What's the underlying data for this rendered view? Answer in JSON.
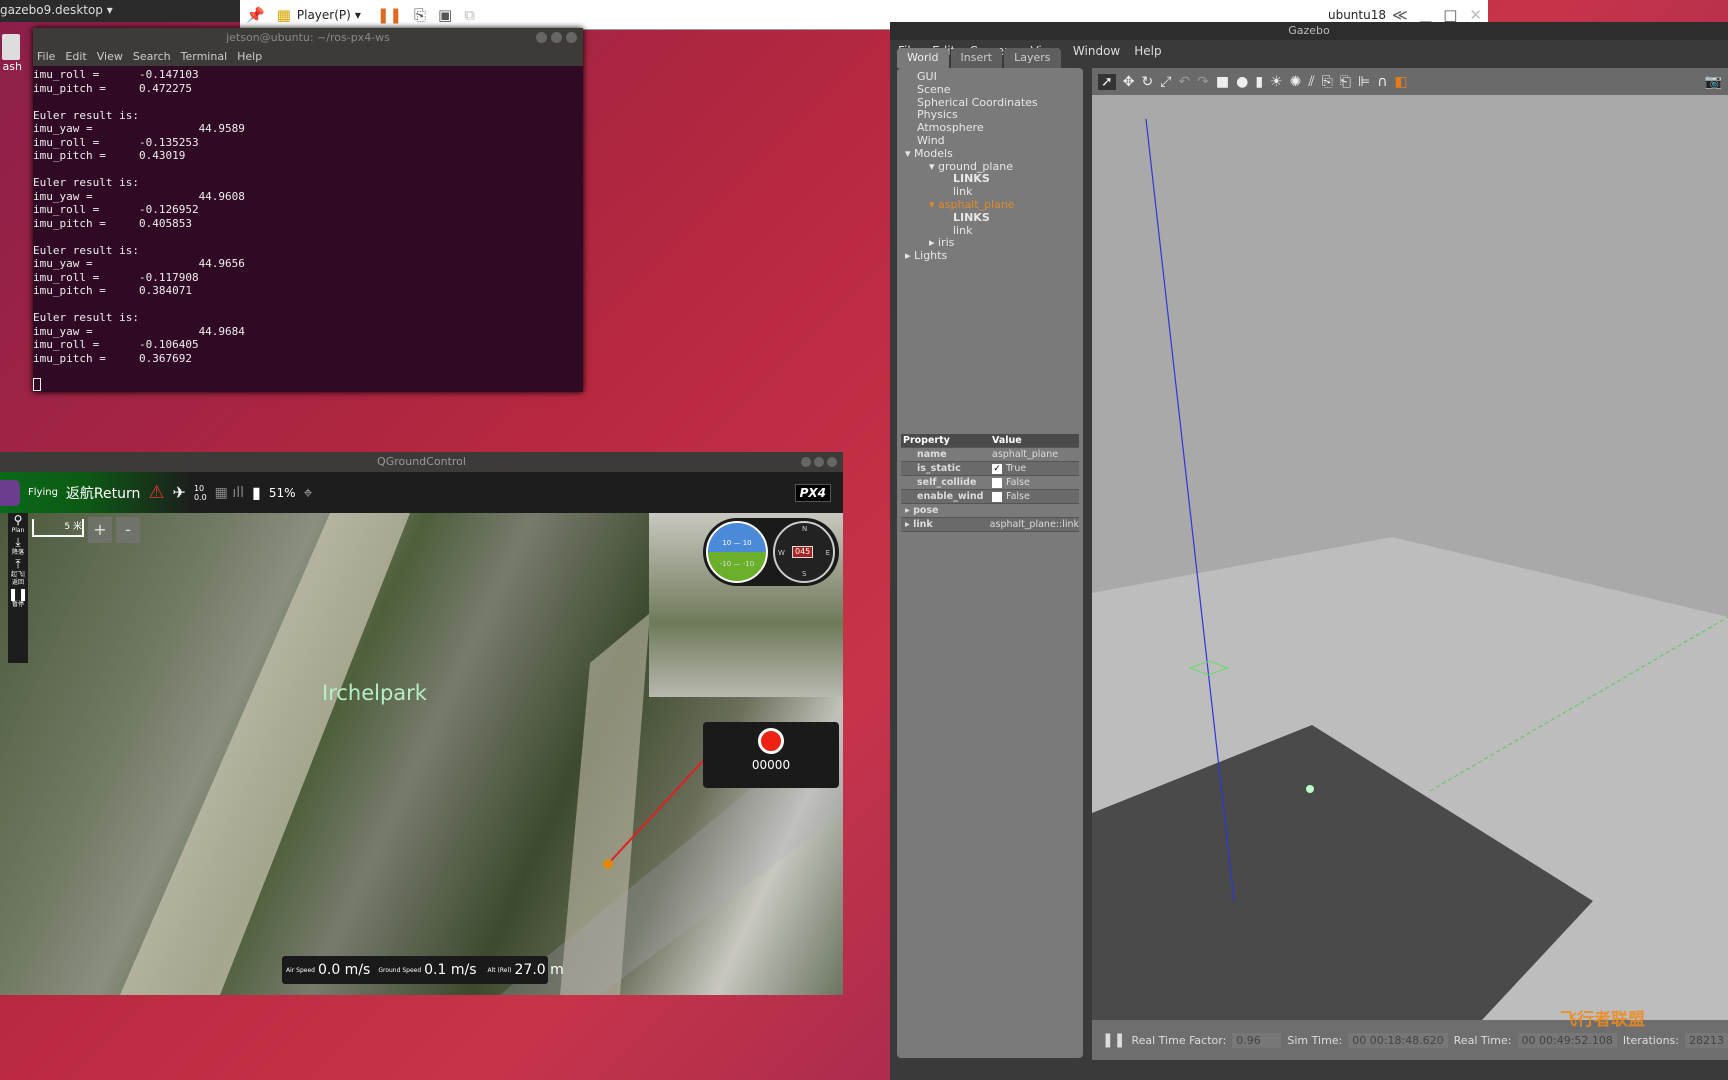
{
  "desktop": {
    "topbar": "gazebo9.desktop ▾",
    "trash": "ash"
  },
  "player": {
    "name": "Player(P)",
    "host": "ubuntu18"
  },
  "terminal": {
    "title": "jetson@ubuntu: ~/ros-px4-ws",
    "menu": [
      "File",
      "Edit",
      "View",
      "Search",
      "Terminal",
      "Help"
    ],
    "lines": [
      "imu_roll =      -0.147103",
      "imu_pitch =     0.472275",
      "",
      "Euler result is:",
      "imu_yaw =                44.9589",
      "imu_roll =      -0.135253",
      "imu_pitch =     0.43019",
      "",
      "Euler result is:",
      "imu_yaw =                44.9608",
      "imu_roll =      -0.126952",
      "imu_pitch =     0.405853",
      "",
      "Euler result is:",
      "imu_yaw =                44.9656",
      "imu_roll =      -0.117908",
      "imu_pitch =     0.384071",
      "",
      "Euler result is:",
      "imu_yaw =                44.9684",
      "imu_roll =      -0.106405",
      "imu_pitch =     0.367692",
      ""
    ]
  },
  "qgc": {
    "title": "QGroundControl",
    "status": "Flying",
    "mode": "返航Return",
    "gps_count": "10",
    "gps_hdop": "0.0",
    "battery": "51%",
    "logo": "PX4 autopilot",
    "scale": "5 米",
    "zoom_in": "+",
    "zoom_out": "-",
    "left_tools": [
      "Plan",
      "降落",
      "起飞|返回",
      "暂停"
    ],
    "place": "Irchelpark",
    "heading": "045",
    "compass": [
      "N",
      "E",
      "S",
      "W"
    ],
    "pitch_labels": [
      "10",
      "10",
      "-10",
      "-10"
    ],
    "record_counter": "00000",
    "telemetry": {
      "air_label": "Air Speed",
      "air": "0.0 m/s",
      "ground_label": "Ground Speed",
      "ground": "0.1 m/s",
      "alt_label": "Alt (Rel)",
      "alt": "27.0 m"
    }
  },
  "gazebo": {
    "title": "Gazebo",
    "menu": [
      "File",
      "Edit",
      "Camera",
      "View",
      "Window",
      "Help"
    ],
    "tabs": [
      "World",
      "Insert",
      "Layers"
    ],
    "tree": [
      {
        "t": "GUI",
        "d": 0
      },
      {
        "t": "Scene",
        "d": 0
      },
      {
        "t": "Spherical Coordinates",
        "d": 0
      },
      {
        "t": "Physics",
        "d": 0
      },
      {
        "t": "Atmosphere",
        "d": 0
      },
      {
        "t": "Wind",
        "d": 0
      },
      {
        "t": "▾ Models",
        "d": -1
      },
      {
        "t": "▾ ground_plane",
        "d": 1
      },
      {
        "t": "LINKS",
        "d": 3,
        "b": true
      },
      {
        "t": "link",
        "d": 3
      },
      {
        "t": "▾ asphalt_plane",
        "d": 1,
        "sel": true
      },
      {
        "t": "LINKS",
        "d": 3,
        "b": true
      },
      {
        "t": "link",
        "d": 3
      },
      {
        "t": "▸ iris",
        "d": 1
      },
      {
        "t": "▸ Lights",
        "d": -1
      }
    ],
    "props": {
      "h_prop": "Property",
      "h_val": "Value",
      "rows": [
        {
          "k": "name",
          "v": "asphalt_plane"
        },
        {
          "k": "is_static",
          "v": "True",
          "chk": true
        },
        {
          "k": "self_collide",
          "v": "False",
          "chk": false
        },
        {
          "k": "enable_wind",
          "v": "False",
          "chk": false
        },
        {
          "k": "▸ pose",
          "v": ""
        },
        {
          "k": "▸ link",
          "v": "asphalt_plane::link"
        }
      ]
    },
    "bottom": {
      "rtf_label": "Real Time Factor:",
      "rtf": "0.96",
      "sim_label": "Sim Time:",
      "sim": "00 00:18:48.620",
      "real_label": "Real Time:",
      "real": "00 00:49:52.108",
      "iter_label": "Iterations:",
      "iter": "28213"
    }
  },
  "watermark": "飞行者联盟 China Flier",
  "colors": {
    "terminal_bg": "#300a24",
    "selected": "#e08a2a",
    "qgc_green": "#0a6a18"
  }
}
